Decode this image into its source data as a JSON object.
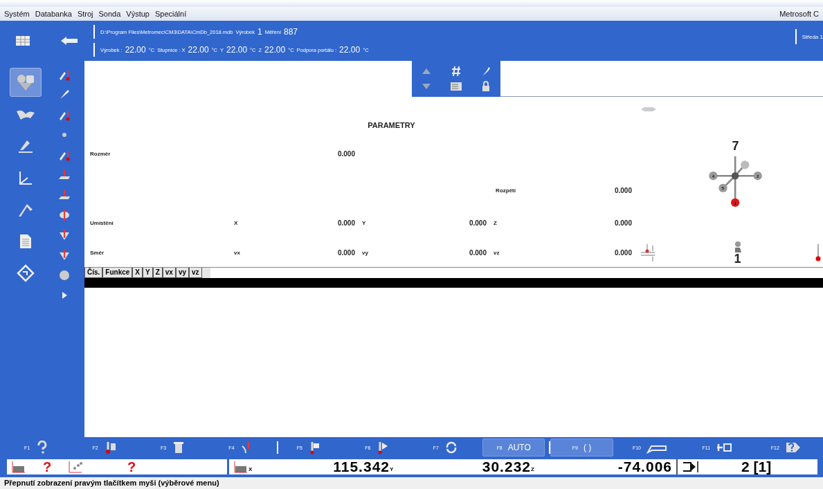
{
  "menu": {
    "items": [
      "Systém",
      "Databanka",
      "Stroj",
      "Sonda",
      "Výstup",
      "Speciální"
    ],
    "app_title": "Metrosoft C"
  },
  "header": {
    "path": "D:\\Program Files\\Metromec\\CM3\\DATA\\CmDb_2018.mdb",
    "fields": [
      {
        "label": "Výrobek",
        "value": "1"
      },
      {
        "label": "Měření",
        "value": "887"
      }
    ],
    "temperatures": [
      {
        "label": "Výrobek :",
        "value": "22.00",
        "unit": "°C"
      },
      {
        "label": "Stupnice :  X",
        "value": "22.00",
        "unit": "°C"
      },
      {
        "label": "Y",
        "value": "22.00",
        "unit": "°C"
      },
      {
        "label": "Z",
        "value": "22.00",
        "unit": "°C"
      },
      {
        "label": "Podpora portálu :",
        "value": "22.00",
        "unit": "°C"
      }
    ],
    "day": "Středa 1"
  },
  "sidebar": {
    "tools": [
      {
        "selected": true
      },
      {
        "selected": false
      },
      {
        "selected": false
      },
      {
        "selected": false
      },
      {
        "selected": false
      },
      {
        "selected": false
      },
      {
        "selected": false
      }
    ]
  },
  "parameters": {
    "title": "PARAMETRY",
    "size": {
      "label": "Rozměr",
      "value": "0.000"
    },
    "span": {
      "label": "Rozpětí",
      "value": "0.000"
    },
    "location": {
      "label": "Umístění",
      "cells": [
        {
          "axis": "X",
          "value": "0.000"
        },
        {
          "axis": "Y",
          "value": "0.000"
        },
        {
          "axis": "Z",
          "value": "0.000"
        }
      ]
    },
    "direction": {
      "label": "Směr",
      "cells": [
        {
          "axis": "vx",
          "value": "0.000"
        },
        {
          "axis": "vy",
          "value": "0.000"
        },
        {
          "axis": "vz",
          "value": "0.000"
        }
      ]
    }
  },
  "probe": {
    "count": "7",
    "tips": [
      {
        "label": "4",
        "selected": false
      },
      {
        "label": "5",
        "selected": false
      },
      {
        "label": "2",
        "selected": false
      },
      {
        "label": "1",
        "selected": true
      }
    ],
    "number": "1"
  },
  "table": {
    "columns": [
      "Čís.",
      "Funkce",
      "X",
      "Y",
      "Z",
      "vx",
      "vy",
      "vz"
    ]
  },
  "function_keys": [
    {
      "key": "F1",
      "active": false
    },
    {
      "key": "F2",
      "active": false
    },
    {
      "key": "F3",
      "active": false
    },
    {
      "key": "F4",
      "active": false
    },
    {
      "key": "F5",
      "active": false
    },
    {
      "key": "F6",
      "active": false
    },
    {
      "key": "F7",
      "active": false
    },
    {
      "key": "F8",
      "text": "AUTO",
      "active": true
    },
    {
      "key": "F9",
      "text": "( )",
      "active": true
    },
    {
      "key": "F10",
      "active": false
    },
    {
      "key": "F11",
      "active": false
    },
    {
      "key": "F12",
      "active": false
    }
  ],
  "readout": {
    "left": [
      "?",
      "?"
    ],
    "axes": [
      {
        "axis": "X",
        "value": "115.342"
      },
      {
        "axis": "Y",
        "value": "30.232"
      },
      {
        "axis": "Z",
        "value": "-74.006"
      }
    ],
    "count": "2 [1]"
  },
  "status_bar": "Přepnutí zobrazení pravým tlačítkem myši (výběrové menu)"
}
